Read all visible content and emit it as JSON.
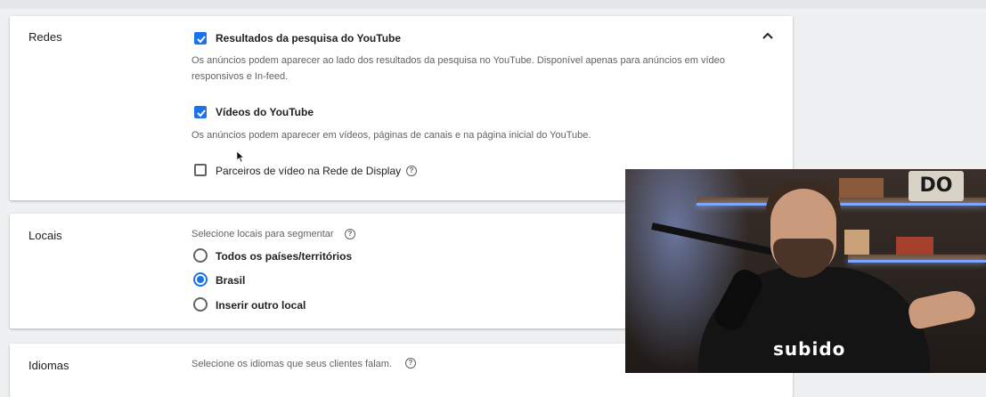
{
  "redes": {
    "title": "Redes",
    "options": [
      {
        "label": "Resultados da pesquisa do YouTube",
        "checked": true,
        "description": "Os anúncios podem aparecer ao lado dos resultados da pesquisa no YouTube. Disponível apenas para anúncios em vídeo responsivos e In-feed."
      },
      {
        "label": "Vídeos do YouTube",
        "checked": true,
        "description": "Os anúncios podem aparecer em vídeos, páginas de canais e na página inicial do YouTube."
      },
      {
        "label": "Parceiros de vídeo na Rede de Display",
        "checked": false
      }
    ]
  },
  "locais": {
    "title": "Locais",
    "hint": "Selecione locais para segmentar",
    "options": [
      {
        "label": "Todos os países/territórios",
        "selected": false
      },
      {
        "label": "Brasil",
        "selected": true
      },
      {
        "label": "Inserir outro local",
        "selected": false
      }
    ]
  },
  "idiomas": {
    "title": "Idiomas",
    "hint": "Selecione os idiomas que seus clientes falam."
  },
  "webcam": {
    "shirt_text": "subido",
    "logo_text": "DO"
  },
  "icons": {
    "help": "?",
    "collapse": "chevron-up-icon"
  },
  "colors": {
    "accent": "#1a73e8",
    "text_primary": "#202124",
    "text_secondary": "#5f6368"
  }
}
